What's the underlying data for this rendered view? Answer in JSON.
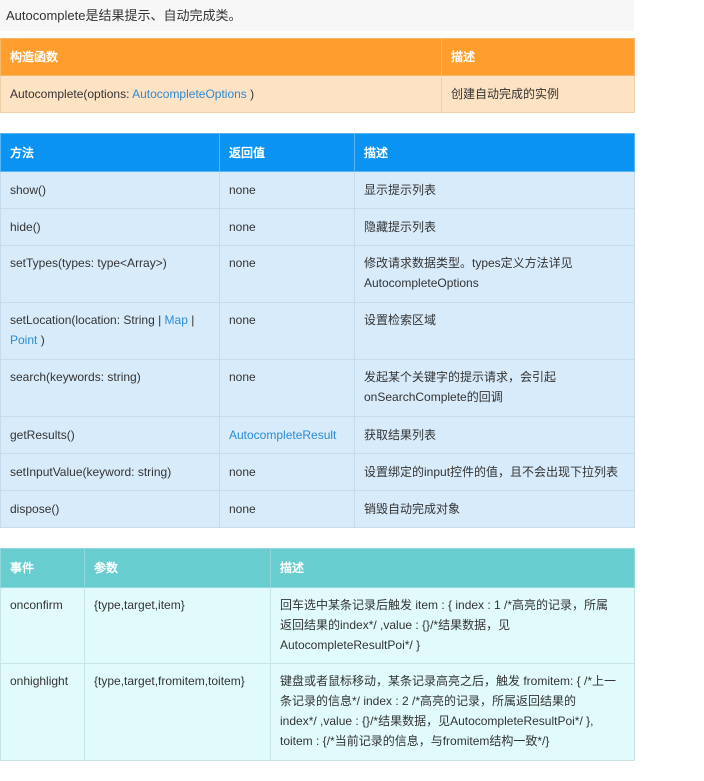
{
  "intro": "Autocomplete是结果提示、自动完成类。",
  "constructor_table": {
    "headers": [
      "构造函数",
      "描述"
    ],
    "row": {
      "prefix": "Autocomplete(options: ",
      "link": "AutocompleteOptions",
      "suffix": " )",
      "desc": "创建自动完成的实例"
    }
  },
  "methods_table": {
    "headers": [
      "方法",
      "返回值",
      "描述"
    ],
    "rows": [
      {
        "method": "show()",
        "ret": "none",
        "desc": "显示提示列表"
      },
      {
        "method": "hide()",
        "ret": "none",
        "desc": "隐藏提示列表"
      },
      {
        "method": "setTypes(types: type<Array>)",
        "ret": "none",
        "desc_line1": "修改请求数据类型。types定义方法详见",
        "desc_line2": "AutocompleteOptions"
      },
      {
        "method_prefix": "setLocation(location: String | ",
        "method_link1": "Map",
        "method_sep": " | ",
        "method_link2": "Point",
        "method_suffix": " )",
        "ret": "none",
        "desc": "设置检索区域"
      },
      {
        "method": "search(keywords: string)",
        "ret": "none",
        "desc_line1": "发起某个关键字的提示请求，会引起",
        "desc_line2": "onSearchComplete的回调"
      },
      {
        "method": "getResults()",
        "ret": "AutocompleteResult",
        "desc": "获取结果列表"
      },
      {
        "method": "setInputValue(keyword: string)",
        "ret": "none",
        "desc": "设置绑定的input控件的值，且不会出现下拉列表"
      },
      {
        "method": "dispose()",
        "ret": "none",
        "desc": "销毁自动完成对象"
      }
    ]
  },
  "events_table": {
    "headers": [
      "事件",
      "参数",
      "描述"
    ],
    "rows": [
      {
        "event": "onconfirm",
        "params": "{type,target,item}",
        "desc_lines": [
          "回车选中某条记录后触发 item : { index : 1 /*高亮的记录，所属",
          "返回结果的index*/ ,value : {}/*结果数据，见",
          "AutocompleteResultPoi*/ }"
        ]
      },
      {
        "event": "onhighlight",
        "params": "{type,target,fromitem,toitem}",
        "desc_lines": [
          "键盘或者鼠标移动，某条记录高亮之后，触发 fromitem: { /*上一",
          "条记录的信息*/ index : 2 /*高亮的记录，所属返回结果的",
          "index*/ ,value : {}/*结果数据，见AutocompleteResultPoi*/ },",
          "toitem : {/*当前记录的信息，与fromitem结构一致*/}"
        ]
      }
    ]
  }
}
